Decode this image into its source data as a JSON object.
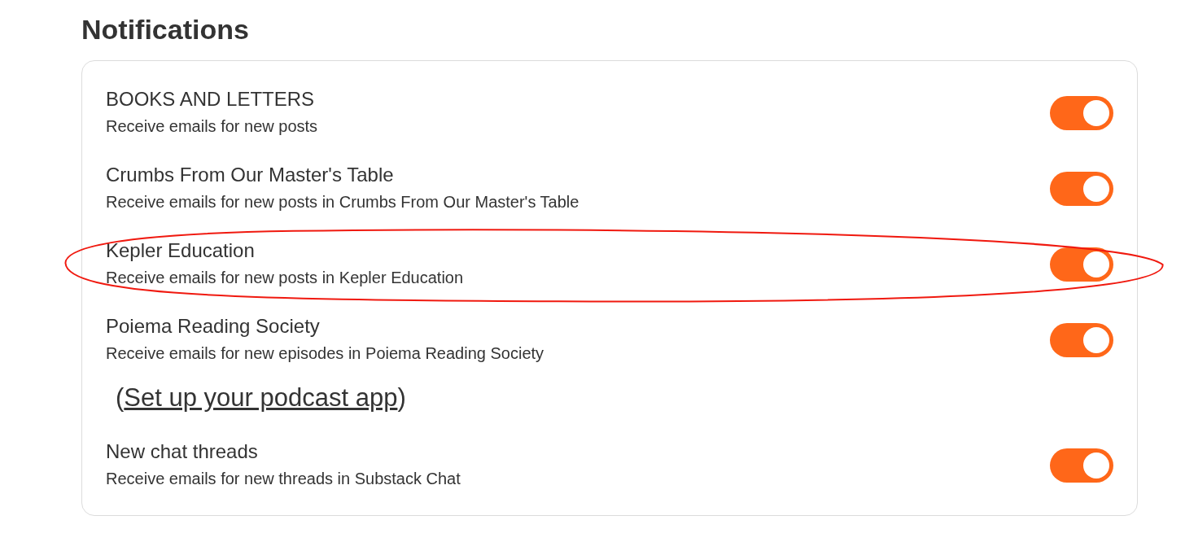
{
  "title": "Notifications",
  "items": [
    {
      "kind": "toggle",
      "name": "BOOKS AND LETTERS",
      "description": "Receive emails for new posts",
      "on": true,
      "circled": false
    },
    {
      "kind": "toggle",
      "name": "Crumbs From Our Master's Table",
      "description": "Receive emails for new posts in Crumbs From Our Master's Table",
      "on": true,
      "circled": false
    },
    {
      "kind": "toggle",
      "name": "Kepler Education",
      "description": "Receive emails for new posts in Kepler Education",
      "on": true,
      "circled": true
    },
    {
      "kind": "toggle",
      "name": "Poiema Reading Society",
      "description": "Receive emails for new episodes in Poiema Reading Society",
      "on": true,
      "circled": false
    },
    {
      "kind": "link",
      "prefix": "(",
      "label": "Set up your podcast app",
      "suffix": ")"
    },
    {
      "kind": "toggle",
      "name": "New chat threads",
      "description": "Receive emails for new threads in Substack Chat",
      "on": true,
      "circled": false
    }
  ]
}
